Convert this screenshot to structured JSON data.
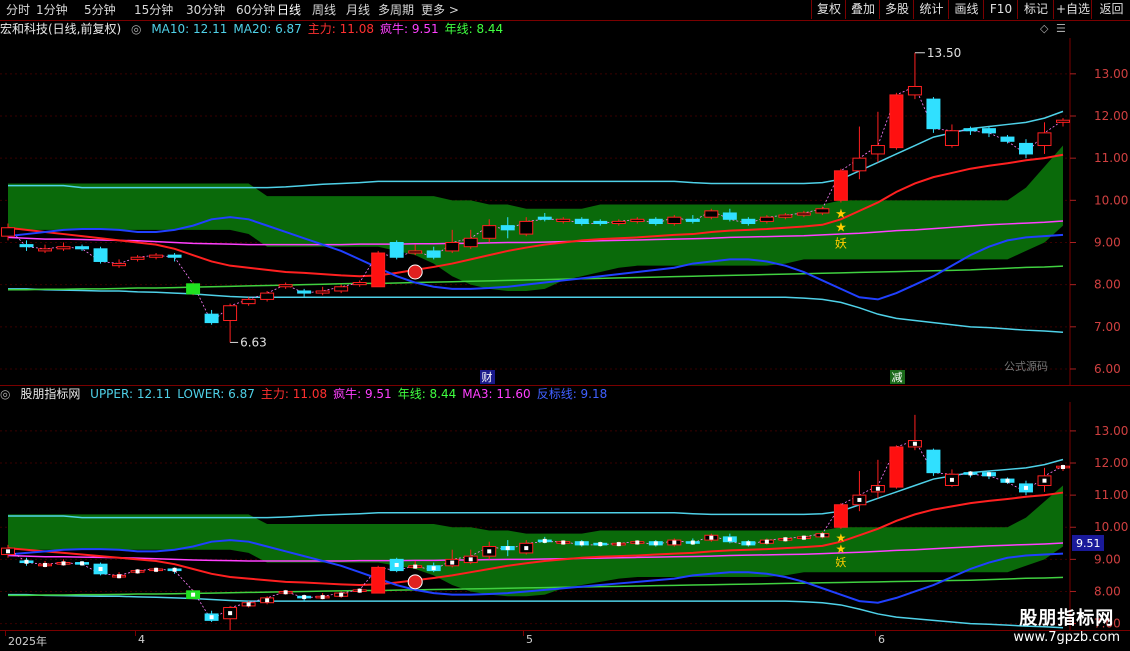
{
  "toolbar": {
    "periods": [
      "分时",
      "1分钟",
      "5分钟",
      "15分钟",
      "30分钟",
      "60分钟",
      "日线",
      "周线",
      "月线",
      "多周期",
      "更多 >"
    ],
    "active_period": "日线",
    "right_buttons": [
      "复权",
      "叠加",
      "多股",
      "统计",
      "画线",
      "F10",
      "标记",
      "+自选",
      "返回"
    ]
  },
  "main_legend": {
    "title": "宏和科技(日线,前复权)",
    "items": [
      {
        "text": "MA10: 12.11",
        "color": "#4fd1e8"
      },
      {
        "text": "MA20: 6.87",
        "color": "#4fd1e8"
      },
      {
        "text": "主力: 11.08",
        "color": "#ff3030"
      },
      {
        "text": "疯牛: 9.51",
        "color": "#ff40ff"
      },
      {
        "text": "年线: 8.44",
        "color": "#40ff40"
      }
    ]
  },
  "sub_legend": {
    "title": "股朋指标网",
    "items": [
      {
        "text": "UPPER: 12.11",
        "color": "#4fd1e8"
      },
      {
        "text": "LOWER: 6.87",
        "color": "#4fd1e8"
      },
      {
        "text": "主力: 11.08",
        "color": "#ff3030"
      },
      {
        "text": "疯牛: 9.51",
        "color": "#ff40ff"
      },
      {
        "text": "年线: 8.44",
        "color": "#40ff40"
      },
      {
        "text": "MA3: 11.60",
        "color": "#ff40ff"
      },
      {
        "text": "反标线: 9.18",
        "color": "#4060ff"
      }
    ]
  },
  "markers": {
    "high": "13.50",
    "low": "6.63",
    "cai": "财",
    "jian": "减",
    "yao": "妖",
    "formula_source": "公式源码",
    "price_tag": "9.51"
  },
  "dates": [
    "2025年",
    "4",
    "5",
    "6"
  ],
  "watermark": {
    "line1": "股朋指标网",
    "line2": "www.7gpzb.com"
  },
  "chart_data": {
    "type": "candlestick",
    "y_ticks_main": [
      13.0,
      12.0,
      11.0,
      10.0,
      9.0,
      8.0,
      7.0,
      6.0
    ],
    "y_ticks_sub": [
      13.0,
      12.0,
      11.0,
      10.0,
      9.0,
      8.0,
      7.0
    ],
    "ylim": [
      5.8,
      13.9
    ],
    "candles": [
      [
        9.15,
        9.35,
        9.05,
        9.45
      ],
      [
        8.95,
        8.9,
        8.8,
        9.05
      ],
      [
        8.8,
        8.85,
        8.75,
        8.95
      ],
      [
        8.85,
        8.9,
        8.8,
        9.0
      ],
      [
        8.9,
        8.85,
        8.8,
        8.95
      ],
      [
        8.85,
        8.55,
        8.5,
        8.9
      ],
      [
        8.45,
        8.5,
        8.4,
        8.6
      ],
      [
        8.6,
        8.65,
        8.55,
        8.7
      ],
      [
        8.65,
        8.7,
        8.6,
        8.75
      ],
      [
        8.7,
        8.65,
        8.55,
        8.75
      ],
      [
        7.78,
        8.02,
        7.75,
        8.05
      ],
      [
        7.3,
        7.1,
        7.05,
        7.4
      ],
      [
        7.15,
        7.5,
        6.63,
        7.55
      ],
      [
        7.55,
        7.65,
        7.5,
        7.7
      ],
      [
        7.65,
        7.8,
        7.6,
        7.85
      ],
      [
        7.95,
        8.0,
        7.9,
        8.05
      ],
      [
        7.85,
        7.8,
        7.7,
        7.9
      ],
      [
        7.8,
        7.85,
        7.75,
        7.95
      ],
      [
        7.85,
        7.95,
        7.8,
        8.0
      ],
      [
        8.0,
        8.05,
        7.95,
        8.1
      ],
      [
        7.95,
        8.75,
        7.95,
        8.8
      ],
      [
        9.0,
        8.65,
        8.6,
        9.05
      ],
      [
        8.75,
        8.8,
        8.7,
        8.95
      ],
      [
        8.8,
        8.65,
        8.6,
        8.9
      ],
      [
        8.8,
        9.0,
        8.75,
        9.3
      ],
      [
        8.9,
        9.1,
        8.85,
        9.3
      ],
      [
        9.1,
        9.4,
        9.0,
        9.55
      ],
      [
        9.4,
        9.3,
        9.1,
        9.6
      ],
      [
        9.2,
        9.5,
        9.15,
        9.6
      ],
      [
        9.6,
        9.55,
        9.5,
        9.7
      ],
      [
        9.5,
        9.55,
        9.45,
        9.6
      ],
      [
        9.55,
        9.45,
        9.4,
        9.6
      ],
      [
        9.5,
        9.45,
        9.4,
        9.55
      ],
      [
        9.45,
        9.5,
        9.4,
        9.55
      ],
      [
        9.5,
        9.55,
        9.45,
        9.6
      ],
      [
        9.55,
        9.45,
        9.4,
        9.6
      ],
      [
        9.45,
        9.6,
        9.4,
        9.65
      ],
      [
        9.55,
        9.5,
        9.45,
        9.65
      ],
      [
        9.6,
        9.75,
        9.55,
        9.8
      ],
      [
        9.7,
        9.55,
        9.5,
        9.8
      ],
      [
        9.55,
        9.45,
        9.4,
        9.6
      ],
      [
        9.5,
        9.6,
        9.45,
        9.65
      ],
      [
        9.6,
        9.65,
        9.55,
        9.7
      ],
      [
        9.65,
        9.7,
        9.6,
        9.75
      ],
      [
        9.7,
        9.8,
        9.65,
        9.85
      ],
      [
        10.0,
        10.7,
        9.95,
        10.75
      ],
      [
        10.7,
        11.0,
        10.5,
        11.75
      ],
      [
        11.1,
        11.3,
        10.9,
        12.1
      ],
      [
        11.25,
        12.5,
        11.2,
        12.55
      ],
      [
        12.5,
        12.7,
        12.4,
        13.5
      ],
      [
        12.4,
        11.7,
        11.6,
        12.45
      ],
      [
        11.3,
        11.65,
        11.25,
        11.8
      ],
      [
        11.7,
        11.65,
        11.55,
        11.75
      ],
      [
        11.7,
        11.6,
        11.5,
        11.75
      ],
      [
        11.5,
        11.4,
        11.35,
        11.55
      ],
      [
        11.35,
        11.1,
        11.0,
        11.45
      ],
      [
        11.3,
        11.6,
        11.1,
        11.85
      ],
      [
        11.85,
        11.9,
        11.75,
        11.95
      ]
    ],
    "series": [
      {
        "name": "MA10",
        "values": [
          10.35,
          10.35,
          10.35,
          10.35,
          10.3,
          10.3,
          10.3,
          10.3,
          10.3,
          10.3,
          10.3,
          10.3,
          10.3,
          10.3,
          10.3,
          10.32,
          10.35,
          10.38,
          10.4,
          10.42,
          10.45,
          10.45,
          10.45,
          10.45,
          10.45,
          10.45,
          10.45,
          10.45,
          10.45,
          10.45,
          10.45,
          10.45,
          10.45,
          10.45,
          10.45,
          10.45,
          10.45,
          10.42,
          10.4,
          10.4,
          10.4,
          10.4,
          10.4,
          10.4,
          10.42,
          10.5,
          10.7,
          10.9,
          11.1,
          11.3,
          11.5,
          11.6,
          11.7,
          11.75,
          11.8,
          11.85,
          11.95,
          12.11
        ]
      },
      {
        "name": "MA20",
        "values": [
          7.9,
          7.9,
          7.88,
          7.87,
          7.86,
          7.85,
          7.85,
          7.83,
          7.82,
          7.8,
          7.78,
          7.75,
          7.72,
          7.7,
          7.7,
          7.7,
          7.7,
          7.7,
          7.7,
          7.7,
          7.7,
          7.7,
          7.7,
          7.7,
          7.7,
          7.7,
          7.7,
          7.7,
          7.7,
          7.7,
          7.7,
          7.7,
          7.7,
          7.7,
          7.7,
          7.7,
          7.7,
          7.7,
          7.7,
          7.7,
          7.7,
          7.7,
          7.7,
          7.68,
          7.65,
          7.58,
          7.45,
          7.3,
          7.2,
          7.15,
          7.1,
          7.05,
          7.0,
          6.98,
          6.95,
          6.92,
          6.9,
          6.87
        ]
      },
      {
        "name": "主力",
        "values": [
          9.35,
          9.3,
          9.25,
          9.2,
          9.15,
          9.1,
          9.05,
          9.0,
          8.95,
          8.85,
          8.7,
          8.55,
          8.45,
          8.4,
          8.35,
          8.3,
          8.28,
          8.25,
          8.22,
          8.2,
          8.22,
          8.28,
          8.35,
          8.42,
          8.5,
          8.6,
          8.7,
          8.8,
          8.88,
          8.95,
          9.0,
          9.05,
          9.08,
          9.1,
          9.12,
          9.15,
          9.18,
          9.2,
          9.25,
          9.28,
          9.3,
          9.32,
          9.35,
          9.38,
          9.42,
          9.55,
          9.75,
          9.95,
          10.2,
          10.4,
          10.55,
          10.65,
          10.75,
          10.82,
          10.88,
          10.95,
          11.0,
          11.08
        ]
      },
      {
        "name": "疯牛",
        "values": [
          9.12,
          9.1,
          9.08,
          9.08,
          9.07,
          9.06,
          9.05,
          9.04,
          9.02,
          9.0,
          8.98,
          8.97,
          8.96,
          8.95,
          8.95,
          8.95,
          8.95,
          8.95,
          8.95,
          8.96,
          8.96,
          8.96,
          8.97,
          8.97,
          8.98,
          8.98,
          8.99,
          9.0,
          9.0,
          9.01,
          9.02,
          9.03,
          9.04,
          9.05,
          9.06,
          9.07,
          9.08,
          9.09,
          9.1,
          9.12,
          9.13,
          9.14,
          9.15,
          9.16,
          9.18,
          9.2,
          9.22,
          9.25,
          9.28,
          9.3,
          9.33,
          9.36,
          9.39,
          9.42,
          9.44,
          9.46,
          9.48,
          9.51
        ]
      },
      {
        "name": "年线",
        "values": [
          7.88,
          7.88,
          7.89,
          7.89,
          7.9,
          7.9,
          7.91,
          7.92,
          7.92,
          7.93,
          7.94,
          7.95,
          7.96,
          7.97,
          7.98,
          7.99,
          8.0,
          8.01,
          8.02,
          8.03,
          8.03,
          8.04,
          8.05,
          8.06,
          8.07,
          8.08,
          8.09,
          8.1,
          8.11,
          8.12,
          8.13,
          8.14,
          8.15,
          8.16,
          8.17,
          8.18,
          8.19,
          8.2,
          8.21,
          8.22,
          8.23,
          8.24,
          8.25,
          8.26,
          8.27,
          8.28,
          8.29,
          8.3,
          8.31,
          8.32,
          8.33,
          8.34,
          8.35,
          8.37,
          8.39,
          8.41,
          8.42,
          8.44
        ]
      },
      {
        "name": "反标线",
        "values": [
          9.15,
          9.2,
          9.25,
          9.3,
          9.32,
          9.32,
          9.3,
          9.25,
          9.25,
          9.3,
          9.4,
          9.55,
          9.6,
          9.55,
          9.4,
          9.25,
          9.1,
          8.95,
          8.8,
          8.6,
          8.4,
          8.2,
          8.05,
          7.95,
          7.9,
          7.9,
          7.92,
          7.95,
          8.0,
          8.05,
          8.1,
          8.15,
          8.2,
          8.25,
          8.3,
          8.35,
          8.4,
          8.5,
          8.55,
          8.6,
          8.6,
          8.55,
          8.45,
          8.3,
          8.1,
          7.9,
          7.7,
          7.65,
          7.8,
          8.0,
          8.2,
          8.45,
          8.7,
          8.9,
          9.05,
          9.12,
          9.15,
          9.18
        ]
      },
      {
        "name": "band_upper",
        "values": [
          10.4,
          10.4,
          10.4,
          10.4,
          10.4,
          10.4,
          10.4,
          10.4,
          10.4,
          10.4,
          10.4,
          10.4,
          10.4,
          10.4,
          10.1,
          10.1,
          10.1,
          10.1,
          10.1,
          10.1,
          10.1,
          10.1,
          10.1,
          10.1,
          10.0,
          10.0,
          9.9,
          9.9,
          9.8,
          9.8,
          9.8,
          9.8,
          9.9,
          9.9,
          9.9,
          9.9,
          9.9,
          9.9,
          9.9,
          9.9,
          9.9,
          9.9,
          9.9,
          9.9,
          9.9,
          10.0,
          10.0,
          10.0,
          10.0,
          10.0,
          10.0,
          10.0,
          10.0,
          10.0,
          10.0,
          10.3,
          10.8,
          11.3
        ]
      },
      {
        "name": "band_lower",
        "values": [
          9.3,
          9.3,
          9.3,
          9.3,
          9.3,
          9.3,
          9.3,
          9.3,
          9.3,
          9.3,
          9.3,
          9.3,
          9.3,
          9.2,
          8.9,
          8.9,
          8.9,
          8.9,
          8.9,
          8.9,
          8.9,
          8.8,
          8.7,
          8.5,
          8.2,
          8.0,
          7.9,
          7.85,
          7.85,
          7.9,
          8.1,
          8.2,
          8.3,
          8.4,
          8.45,
          8.45,
          8.45,
          8.45,
          8.45,
          8.45,
          8.45,
          8.45,
          8.5,
          8.6,
          8.6,
          8.6,
          8.6,
          8.6,
          8.6,
          8.6,
          8.6,
          8.6,
          8.6,
          8.6,
          8.6,
          8.8,
          9.0,
          9.4
        ]
      }
    ]
  }
}
